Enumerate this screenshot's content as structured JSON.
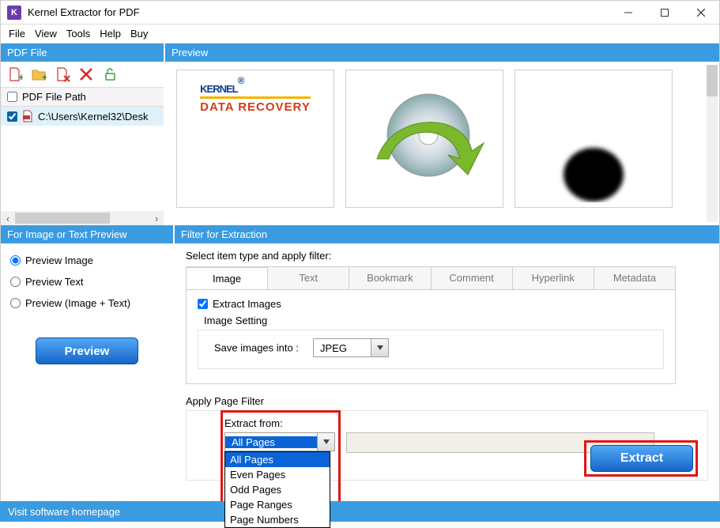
{
  "window": {
    "title": "Kernel Extractor for PDF",
    "app_icon_letter": "K"
  },
  "menu": [
    "File",
    "View",
    "Tools",
    "Help",
    "Buy"
  ],
  "sections": {
    "pdf_file": "PDF File",
    "preview": "Preview",
    "preview_choice": "For Image or Text Preview",
    "filter": "Filter for Extraction"
  },
  "tree": {
    "header": "PDF File Path",
    "rows": [
      {
        "checked": true,
        "path": "C:\\Users\\Kernel32\\Desk"
      }
    ]
  },
  "thumbnails": {
    "logo_top": "KERNEL",
    "logo_mark": "®",
    "logo_bottom": "DATA RECOVERY"
  },
  "preview_options": {
    "opt1": "Preview Image",
    "opt2": "Preview Text",
    "opt3": "Preview (Image + Text)",
    "button": "Preview"
  },
  "filter_panel": {
    "instruction": "Select item type and apply filter:",
    "tabs": [
      "Image",
      "Text",
      "Bookmark",
      "Comment",
      "Hyperlink",
      "Metadata"
    ],
    "extract_images": "Extract Images",
    "image_setting": "Image Setting",
    "save_into_label": "Save images into :",
    "save_into_value": "JPEG",
    "apply_page_filter": "Apply Page Filter",
    "extract_from_label": "Extract from:",
    "extract_from_value": "All Pages",
    "extract_from_options": [
      "All Pages",
      "Even Pages",
      "Odd Pages",
      "Page Ranges",
      "Page Numbers"
    ],
    "extract_button": "Extract"
  },
  "footer": "Visit software homepage"
}
